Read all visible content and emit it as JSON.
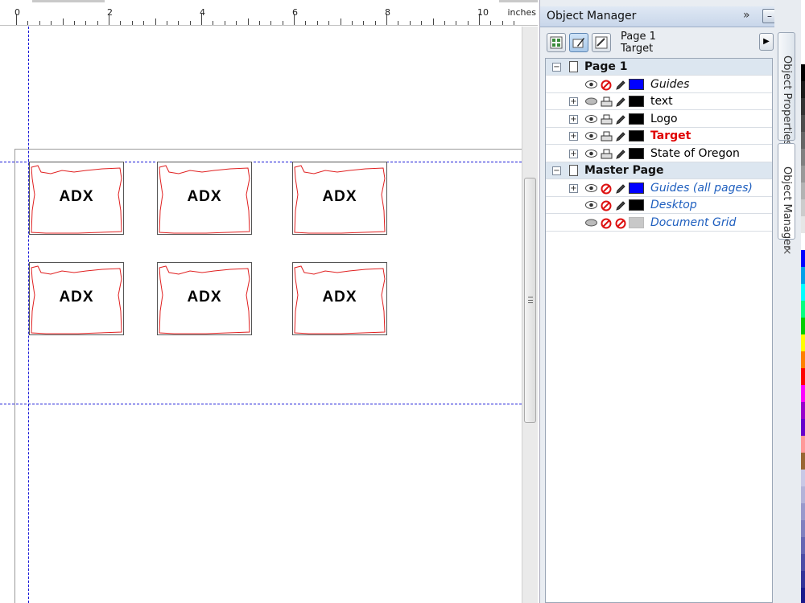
{
  "ruler": {
    "numbers": [
      "0",
      "2",
      "4",
      "6",
      "8",
      "10"
    ],
    "unit": "inches"
  },
  "canvas": {
    "logo_text": "ADX",
    "labels_count_shown": 6
  },
  "object_manager": {
    "title": "Object Manager",
    "current_page": "Page 1",
    "current_layer": "Target",
    "rows": [
      {
        "type": "page",
        "label": "Page 1",
        "expanded": true
      },
      {
        "type": "layer",
        "label": "Guides",
        "style": "italic",
        "color": "#0000ff",
        "expandable": false
      },
      {
        "type": "layer",
        "label": "text",
        "style": "normal",
        "color": "#000000",
        "expandable": true
      },
      {
        "type": "layer",
        "label": "Logo",
        "style": "normal",
        "color": "#000000",
        "expandable": true
      },
      {
        "type": "layer",
        "label": "Target",
        "style": "active",
        "color": "#000000",
        "expandable": true
      },
      {
        "type": "layer",
        "label": "State of Oregon",
        "style": "normal",
        "color": "#000000",
        "expandable": true
      },
      {
        "type": "page",
        "label": "Master Page",
        "expanded": true
      },
      {
        "type": "layer",
        "label": "Guides (all pages)",
        "style": "master",
        "color": "#0000ff",
        "expandable": true
      },
      {
        "type": "layer",
        "label": "Desktop",
        "style": "master",
        "color": "#000000",
        "expandable": false
      },
      {
        "type": "layer",
        "label": "Document Grid",
        "style": "master",
        "color": "#c8c8c8",
        "expandable": false
      }
    ]
  },
  "side_tabs": {
    "object_properties": "Object Properties",
    "object_manager": "Object Manager"
  },
  "palette": [
    "#000000",
    "#1a1a1a",
    "#333333",
    "#4d4d4d",
    "#666666",
    "#808080",
    "#999999",
    "#b3b3b3",
    "#cccccc",
    "#e6e6e6",
    "#ffffff",
    "#0000ff",
    "#00a0e9",
    "#00ffff",
    "#00ff80",
    "#00cc00",
    "#ffff00",
    "#ff8000",
    "#ff0000",
    "#ff00ff",
    "#9900cc",
    "#6600cc",
    "#ff9999",
    "#996633",
    "#c8c8e6",
    "#b3b3d9",
    "#9999cc",
    "#8080bf",
    "#6666b3",
    "#4d4da6",
    "#333399",
    "#1a1a8c"
  ],
  "colors": {
    "guide": "#1a1ad8",
    "oregon_outline": "#e02020",
    "active_layer": "#e00000",
    "master_layer": "#1f5fbf"
  }
}
